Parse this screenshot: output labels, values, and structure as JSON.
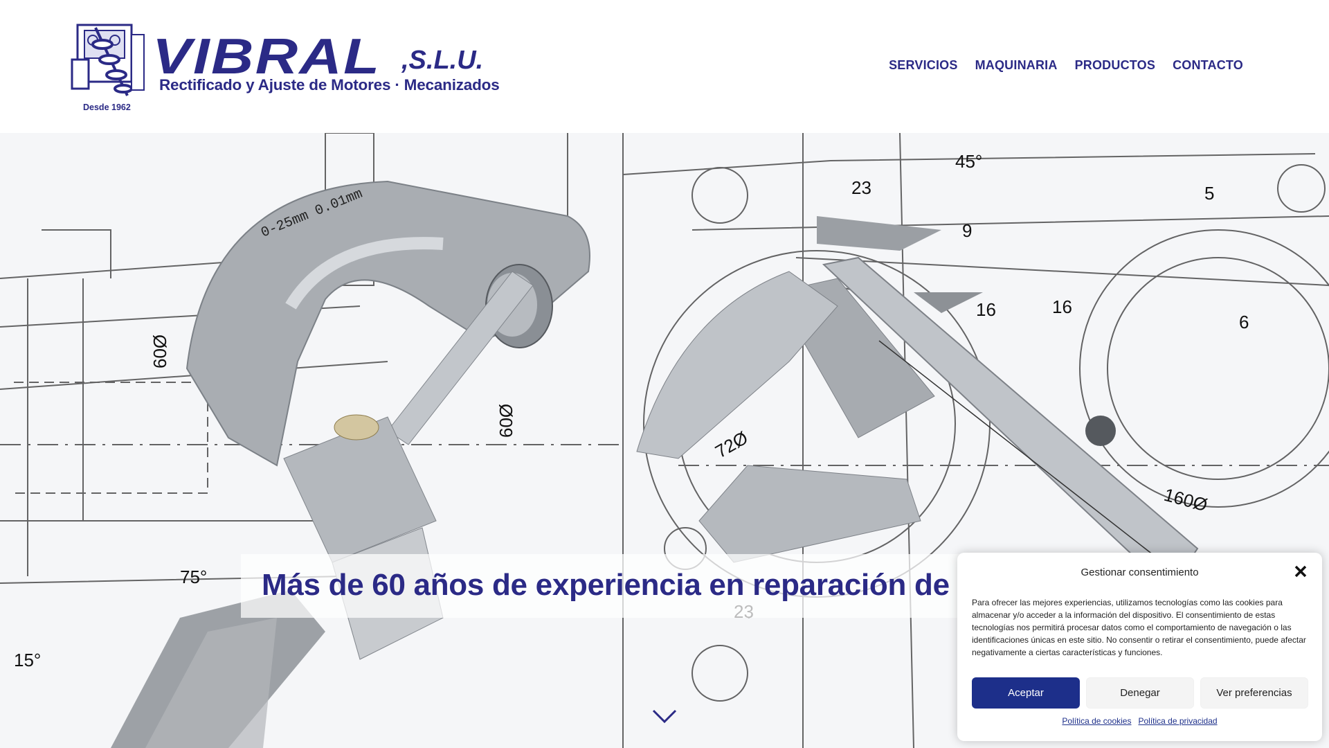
{
  "brand": {
    "name": "VIBRAL",
    "suffix": ",S.L.U.",
    "tagline": "Rectificado y Ajuste de Motores · Mecanizados",
    "since": "Desde 1962",
    "color": "#2b2a86"
  },
  "nav": {
    "items": [
      {
        "label": "SERVICIOS"
      },
      {
        "label": "MAQUINARIA"
      },
      {
        "label": "PRODUCTOS"
      },
      {
        "label": "CONTACTO"
      }
    ]
  },
  "hero": {
    "headline": "Más de 60 años de experiencia en reparación de r",
    "image_description_icon": "scroll-down-chevron-icon"
  },
  "cookie_dialog": {
    "title": "Gestionar consentimiento",
    "body": "Para ofrecer las mejores experiencias, utilizamos tecnologías como las cookies para almacenar y/o acceder a la información del dispositivo. El consentimiento de estas tecnologías nos permitirá procesar datos como el comportamiento de navegación o las identificaciones únicas en este sitio. No consentir o retirar el consentimiento, puede afectar negativamente a ciertas características y funciones.",
    "accept_label": "Aceptar",
    "deny_label": "Denegar",
    "preferences_label": "Ver preferencias",
    "cookie_policy_label": "Política de cookies",
    "privacy_policy_label": "Política de privacidad",
    "accent_color": "#1d2f8a"
  }
}
